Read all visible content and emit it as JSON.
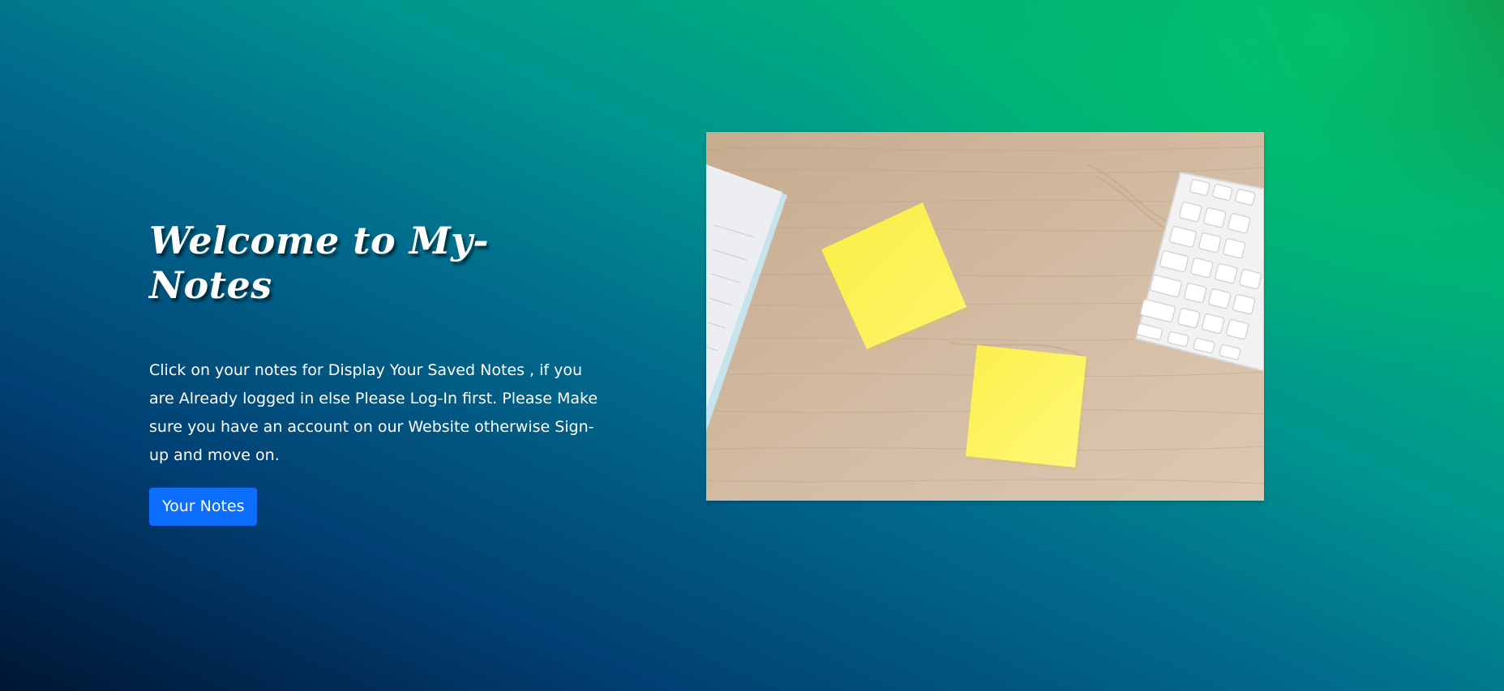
{
  "hero": {
    "title": "Welcome to My-Notes",
    "description": "Click on your notes for Display Your Saved Notes , if you are Already logged in else Please Log-In first. Please Make sure you have an account on our Website otherwise Sign-up and move on.",
    "button_label": "Your Notes",
    "image_icon": "sticky-notes-desk-image"
  },
  "colors": {
    "button": "#0d6efd",
    "text": "#ffffff",
    "sticky_note": "#fdf35c",
    "wood": "#cdb59b"
  }
}
